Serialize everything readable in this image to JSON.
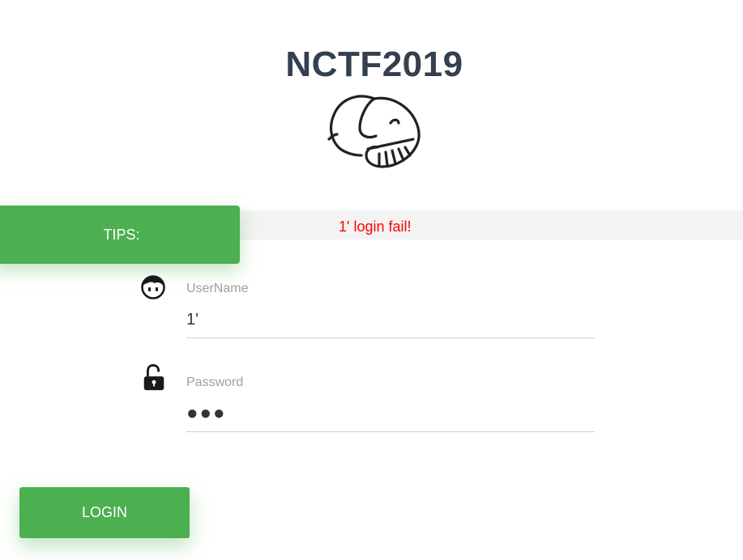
{
  "page": {
    "title": "NCTF2019",
    "logo_icon": "elephant-icon"
  },
  "tips": {
    "label": "TIPS:",
    "message": "1' login fail!",
    "message_color": "#ff0000",
    "accent": "#4caf50"
  },
  "form": {
    "username": {
      "icon": "user-face-icon",
      "label": "UserName",
      "value": "1'"
    },
    "password": {
      "icon": "unlocked-padlock-icon",
      "label": "Password",
      "value": "●●●"
    },
    "login_label": "LOGIN"
  }
}
